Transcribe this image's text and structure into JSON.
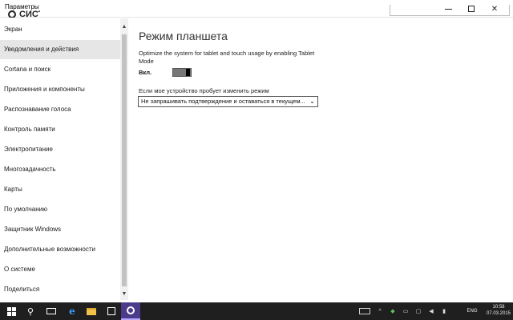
{
  "window": {
    "title": "Параметры",
    "subtitle": "СИСТЕМА",
    "controls": [
      "minimize",
      "maximize",
      "close"
    ]
  },
  "search": {
    "placeholder": ""
  },
  "sidebar": {
    "items": [
      {
        "label": "Экран",
        "active": false
      },
      {
        "label": "Уведомления и действия",
        "active": true
      },
      {
        "label": "Cortana и поиск",
        "active": false
      },
      {
        "label": "Приложения и компоненты",
        "active": false
      },
      {
        "label": "Распознавание голоса",
        "active": false
      },
      {
        "label": "Контроль памяти",
        "active": false
      },
      {
        "label": "Электропитание",
        "active": false
      },
      {
        "label": "Многозадачность",
        "active": false
      },
      {
        "label": "Карты",
        "active": false
      },
      {
        "label": "По умолчанию",
        "active": false
      },
      {
        "label": "Защитник Windows",
        "active": false
      },
      {
        "label": "Дополнительные возможности",
        "active": false
      },
      {
        "label": "О системе",
        "active": false
      },
      {
        "label": "Поделиться",
        "active": false
      }
    ]
  },
  "main": {
    "title": "Режим планшета",
    "description": "Optimize the system for tablet and touch usage by enabling Tablet Mode",
    "toggle": {
      "label": "Вкл.",
      "state": "on"
    },
    "select": {
      "label": "Если мое устройство пробует изменить режим",
      "value": "Не запрашивать подтверждение и оставаться в текущем..."
    }
  },
  "taskbar": {
    "apps": [
      "start-icon",
      "search-icon",
      "task-view-icon",
      "internet-explorer-icon",
      "file-explorer-icon",
      "store-icon",
      "settings-icon"
    ],
    "active_app": "settings-icon",
    "language": "ENG",
    "time": "10:58",
    "date": "07.03.2015"
  },
  "colors": {
    "taskbar_bg": "#1f1f1f",
    "active_app_bg": "#4b3b8a",
    "nav_active_bg": "#e6e6e6",
    "toggle_on": "#000000"
  }
}
